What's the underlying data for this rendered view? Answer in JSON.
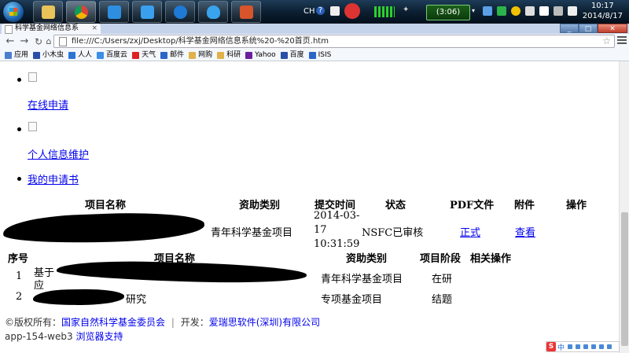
{
  "taskbar": {
    "lang": "CH",
    "help": "?",
    "battery": "(3:06)",
    "time": "10:17",
    "date": "2014/8/17"
  },
  "browser": {
    "tab_title": "科学基金网络信息系",
    "tab_close": "×",
    "url": "file:///C:/Users/zxj/Desktop/科学基金网络信息系统%20-%20首页.htm",
    "bookmarks": [
      {
        "label": "应用",
        "color": "#4a7fd0"
      },
      {
        "label": "小木虫",
        "color": "#2a4ea8"
      },
      {
        "label": "人人",
        "color": "#2b75d6"
      },
      {
        "label": "百度云",
        "color": "#3a8ee6"
      },
      {
        "label": "天气",
        "color": "#d22"
      },
      {
        "label": "邮件",
        "color": "#2a66c8"
      },
      {
        "label": "网购",
        "color": "#e0b24a"
      },
      {
        "label": "科研",
        "color": "#e0b24a"
      },
      {
        "label": "Yahoo",
        "color": "#6b1fa0"
      },
      {
        "label": "百度",
        "color": "#2a4ea8"
      },
      {
        "label": "ISIS",
        "color": "#2a66c8"
      }
    ]
  },
  "menu": {
    "online_apply": "在线申请",
    "profile": "个人信息维护",
    "my_apps": "我的申请书"
  },
  "applications": {
    "headers": [
      "项目名称",
      "资助类别",
      "提交时间",
      "状态",
      "PDF文件",
      "附件",
      "操作"
    ],
    "row": {
      "funding_type": "青年科学基金项目",
      "submit_date": "2014-03-",
      "submit_day": "17",
      "submit_time": "10:31:59",
      "status": "NSFC已审核",
      "pdf": "正式",
      "attachment": "查看"
    }
  },
  "projects": {
    "headers": [
      "序号",
      "项目名称",
      "资助类别",
      "项目阶段",
      "相关操作"
    ],
    "rows": [
      {
        "no": "1",
        "name_start": "基于",
        "name_end": "应",
        "funding_type": "青年科学基金项目",
        "stage": "在研"
      },
      {
        "no": "2",
        "name_start": "",
        "name_end": "研究",
        "funding_type": "专项基金项目",
        "stage": "结题"
      }
    ]
  },
  "footer": {
    "copyright_label": "©版权所有：",
    "copyright_owner": "国家自然科学基金委员会",
    "separator": "|",
    "dev_label": "开发：",
    "developer": "爱瑞思软件(深圳)有限公司",
    "server": "app-154-web3",
    "browser_support": "浏览器支持"
  },
  "ime": {
    "logo": "S",
    "mode": "中"
  }
}
